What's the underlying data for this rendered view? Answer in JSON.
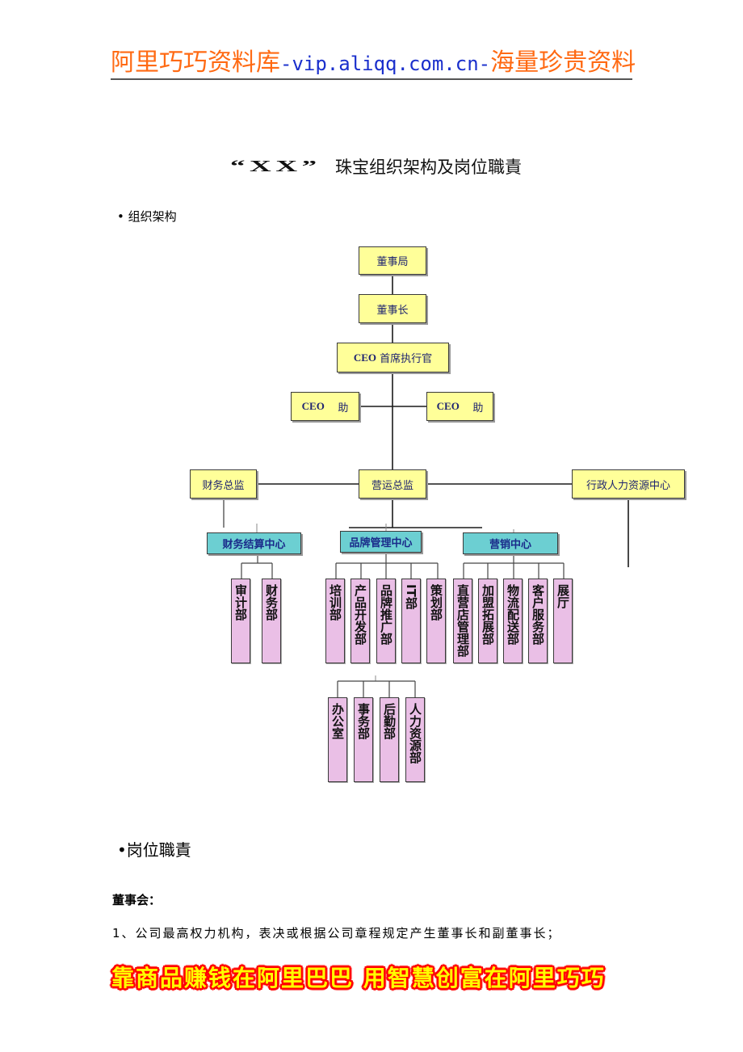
{
  "header": {
    "brand": "阿里巧巧资料库",
    "url": "-vip.aliqq.com.cn-",
    "tagline": "海量珍贵资料"
  },
  "title": {
    "quote": "“XX”",
    "text": "珠宝组织架构及岗位職責"
  },
  "section_org": {
    "bullet": "•",
    "label": "组织架构"
  },
  "org": {
    "board": "董事局",
    "chairman": "董事长",
    "ceo": {
      "prefix": "CEO",
      "text": " 首席执行官"
    },
    "ceo_assistants": [
      {
        "prefix": "CEO",
        "text": "    助"
      },
      {
        "prefix": "CEO",
        "text": "    助"
      }
    ],
    "directors": [
      "财务总监",
      "营运总监",
      "行政人力资源中心"
    ],
    "centers": [
      "财务结算中心",
      "品牌管理中心",
      "营销中心"
    ],
    "finance_depts": [
      "审计部",
      "财务部"
    ],
    "brand_depts": [
      "培训部",
      "产品开发部",
      "品牌推广部",
      "IT部",
      "策划部"
    ],
    "marketing_depts": [
      "直营店管理部",
      "加盟拓展部",
      "物流配送部",
      "客户服务部",
      "展厅"
    ],
    "admin_depts": [
      "办公室",
      "事务部",
      "后勤部",
      "人力资源部"
    ]
  },
  "section_duties": {
    "bullet": "•",
    "label": "岗位職責"
  },
  "board_section": {
    "heading": "董事会：",
    "duties": [
      "1、公司最高权力机构，表决或根据公司章程规定产生董事长和副董事长；"
    ]
  },
  "footer": {
    "slogan": "靠商品赚钱在阿里巴巴 用智慧创富在阿里巧巧"
  },
  "colors": {
    "header_orange": "#ff6a13",
    "header_blue": "#1a2fcc",
    "exec_box": "#ffff99",
    "center_box": "#6ccfd2",
    "dept_box": "#eabfe6",
    "footer_fill": "#ffff00",
    "footer_outline": "#ff0000"
  }
}
